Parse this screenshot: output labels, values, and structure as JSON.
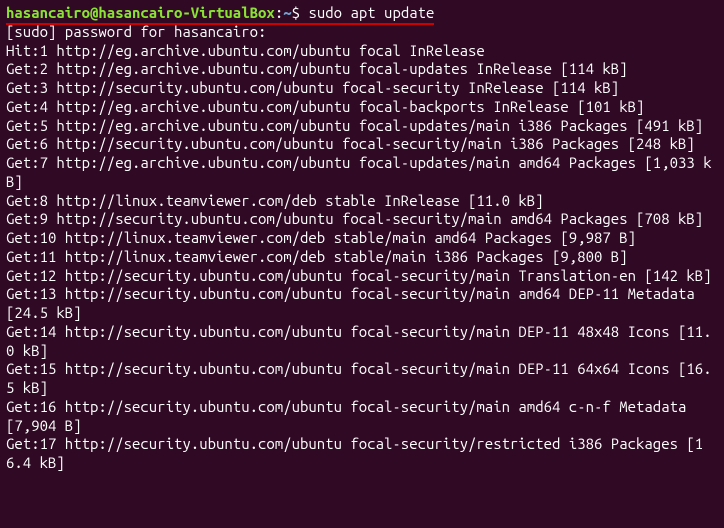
{
  "prompt": {
    "user_host": "hasancairo@hasancairo-VirtualBox",
    "colon": ":",
    "path": "~",
    "dollar": "$ ",
    "command": "sudo apt update"
  },
  "lines": [
    "[sudo] password for hasancairo:",
    "Hit:1 http://eg.archive.ubuntu.com/ubuntu focal InRelease",
    "Get:2 http://eg.archive.ubuntu.com/ubuntu focal-updates InRelease [114 kB]",
    "Get:3 http://security.ubuntu.com/ubuntu focal-security InRelease [114 kB]",
    "Get:4 http://eg.archive.ubuntu.com/ubuntu focal-backports InRelease [101 kB]",
    "Get:5 http://eg.archive.ubuntu.com/ubuntu focal-updates/main i386 Packages [491 kB]",
    "Get:6 http://security.ubuntu.com/ubuntu focal-security/main i386 Packages [248 kB]",
    "Get:7 http://eg.archive.ubuntu.com/ubuntu focal-updates/main amd64 Packages [1,033 kB]",
    "Get:8 http://linux.teamviewer.com/deb stable InRelease [11.0 kB]",
    "Get:9 http://security.ubuntu.com/ubuntu focal-security/main amd64 Packages [708 kB]",
    "Get:10 http://linux.teamviewer.com/deb stable/main amd64 Packages [9,987 B]",
    "Get:11 http://linux.teamviewer.com/deb stable/main i386 Packages [9,800 B]",
    "Get:12 http://security.ubuntu.com/ubuntu focal-security/main Translation-en [142 kB]",
    "Get:13 http://security.ubuntu.com/ubuntu focal-security/main amd64 DEP-11 Metadata [24.5 kB]",
    "Get:14 http://security.ubuntu.com/ubuntu focal-security/main DEP-11 48x48 Icons [11.0 kB]",
    "Get:15 http://security.ubuntu.com/ubuntu focal-security/main DEP-11 64x64 Icons [16.5 kB]",
    "Get:16 http://security.ubuntu.com/ubuntu focal-security/main amd64 c-n-f Metadata [7,904 B]",
    "Get:17 http://security.ubuntu.com/ubuntu focal-security/restricted i386 Packages [16.4 kB]"
  ]
}
